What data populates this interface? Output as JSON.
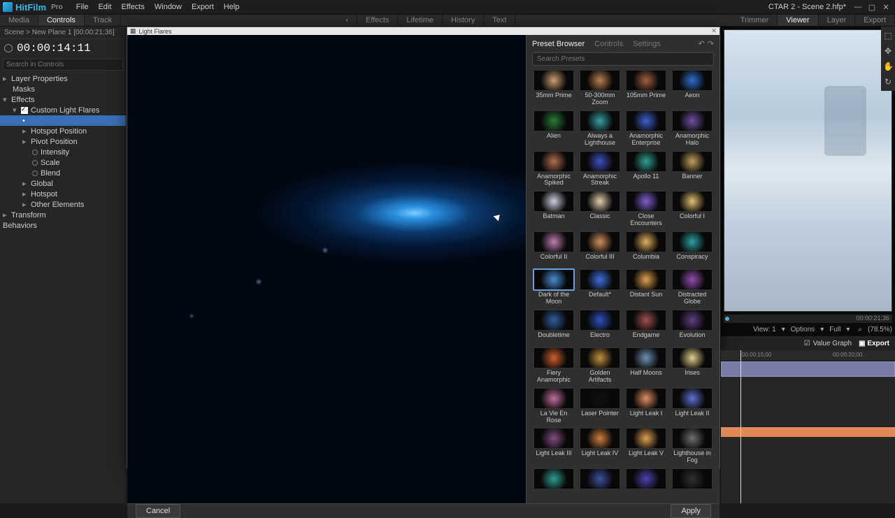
{
  "app": {
    "name": "HitFilm",
    "edition": "Pro",
    "project_title": "CTAR 2 - Scene 2.hfp*"
  },
  "menu": [
    "File",
    "Edit",
    "Effects",
    "Window",
    "Export",
    "Help"
  ],
  "left_tabs": [
    "Media",
    "Controls",
    "Track"
  ],
  "left_active_tab": "Controls",
  "center_tabs": [
    "Effects",
    "Lifetime",
    "History",
    "Text"
  ],
  "right_tabs": [
    "Trimmer",
    "Viewer",
    "Layer",
    "Export"
  ],
  "right_active_tab": "Viewer",
  "breadcrumb": "Scene > New Plane 1 [00:00:21;36]",
  "timecode": "00:00:14:11",
  "search_placeholder": "Search in Controls",
  "tree": {
    "layer_properties": "Layer Properties",
    "masks": "Masks",
    "effects": "Effects",
    "custom_light_flares": "Custom Light Flares",
    "selected_row": "",
    "hotspot_position": "Hotspot Position",
    "pivot_position": "Pivot Position",
    "intensity": "Intensity",
    "scale": "Scale",
    "blend": "Blend",
    "global": "Global",
    "hotspot": "Hotspot",
    "other_elements": "Other Elements",
    "transform": "Transform",
    "behaviors": "Behaviors"
  },
  "modal": {
    "title": "Light Flares",
    "tabs": {
      "preset_browser": "Preset Browser",
      "controls": "Controls",
      "settings": "Settings"
    },
    "search_placeholder": "Search Presets",
    "cancel": "Cancel",
    "apply": "Apply",
    "selected": "Dark of the Moon",
    "presets": [
      {
        "n": "35mm Prime",
        "c": "#caa070"
      },
      {
        "n": "50-300mm Zoom",
        "c": "#b88050"
      },
      {
        "n": "105mm Prime",
        "c": "#a06040"
      },
      {
        "n": "Aeon",
        "c": "#3070d0"
      },
      {
        "n": "Alien",
        "c": "#2a7a3a"
      },
      {
        "n": "Always a Lighthouse",
        "c": "#3aa0a0"
      },
      {
        "n": "Anamorphic Enterprise",
        "c": "#4060d0"
      },
      {
        "n": "Anamorphic Halo",
        "c": "#7050a0"
      },
      {
        "n": "Anamorphic Spiked",
        "c": "#b07050"
      },
      {
        "n": "Anamorphic Streak",
        "c": "#4050c0"
      },
      {
        "n": "Apollo 11",
        "c": "#30a090"
      },
      {
        "n": "Banner",
        "c": "#c0a060"
      },
      {
        "n": "Batman",
        "c": "#d0d0e0"
      },
      {
        "n": "Classic",
        "c": "#e0d0b0"
      },
      {
        "n": "Close Encounters",
        "c": "#8060d0"
      },
      {
        "n": "Colorful I",
        "c": "#e0c070"
      },
      {
        "n": "Colorful II",
        "c": "#c080b0"
      },
      {
        "n": "Colorful III",
        "c": "#d09060"
      },
      {
        "n": "Columbia",
        "c": "#e0b060"
      },
      {
        "n": "Conspiracy",
        "c": "#30a0a0"
      },
      {
        "n": "Dark of the Moon",
        "c": "#4a90d8"
      },
      {
        "n": "Default*",
        "c": "#4070e0"
      },
      {
        "n": "Distant Sun",
        "c": "#e0a050"
      },
      {
        "n": "Distracted Globe",
        "c": "#9050b0"
      },
      {
        "n": "Doubletime",
        "c": "#3060a0"
      },
      {
        "n": "Electro",
        "c": "#3050c0"
      },
      {
        "n": "Endgame",
        "c": "#a05050"
      },
      {
        "n": "Evolution",
        "c": "#604080"
      },
      {
        "n": "Fiery Anamorphic",
        "c": "#d06030"
      },
      {
        "n": "Golden Artifacts",
        "c": "#c09040"
      },
      {
        "n": "Half Moons",
        "c": "#7090b0"
      },
      {
        "n": "Irises",
        "c": "#e0d090"
      },
      {
        "n": "La Vie En Rose",
        "c": "#c070a0"
      },
      {
        "n": "Laser Pointer",
        "c": "#101010"
      },
      {
        "n": "Light Leak I",
        "c": "#e09060"
      },
      {
        "n": "Light Leak II",
        "c": "#6070d0"
      },
      {
        "n": "Light Leak III",
        "c": "#805080"
      },
      {
        "n": "Light Leak IV",
        "c": "#d08040"
      },
      {
        "n": "Light Leak V",
        "c": "#e0a050"
      },
      {
        "n": "Lighthouse in Fog",
        "c": "#707070"
      },
      {
        "n": "",
        "c": "#30a090"
      },
      {
        "n": "",
        "c": "#4050a0"
      },
      {
        "n": "",
        "c": "#5040b0"
      },
      {
        "n": "",
        "c": "#303030"
      }
    ]
  },
  "viewer": {
    "view_label": "View: 1",
    "options": "Options",
    "full": "Full",
    "zoom": "(78.5%)",
    "duration": "00:00:21;36",
    "value_graph": "Value Graph",
    "export": "Export",
    "ruler_ticks": [
      "00:00:15;00",
      "00:00:20;00"
    ]
  }
}
